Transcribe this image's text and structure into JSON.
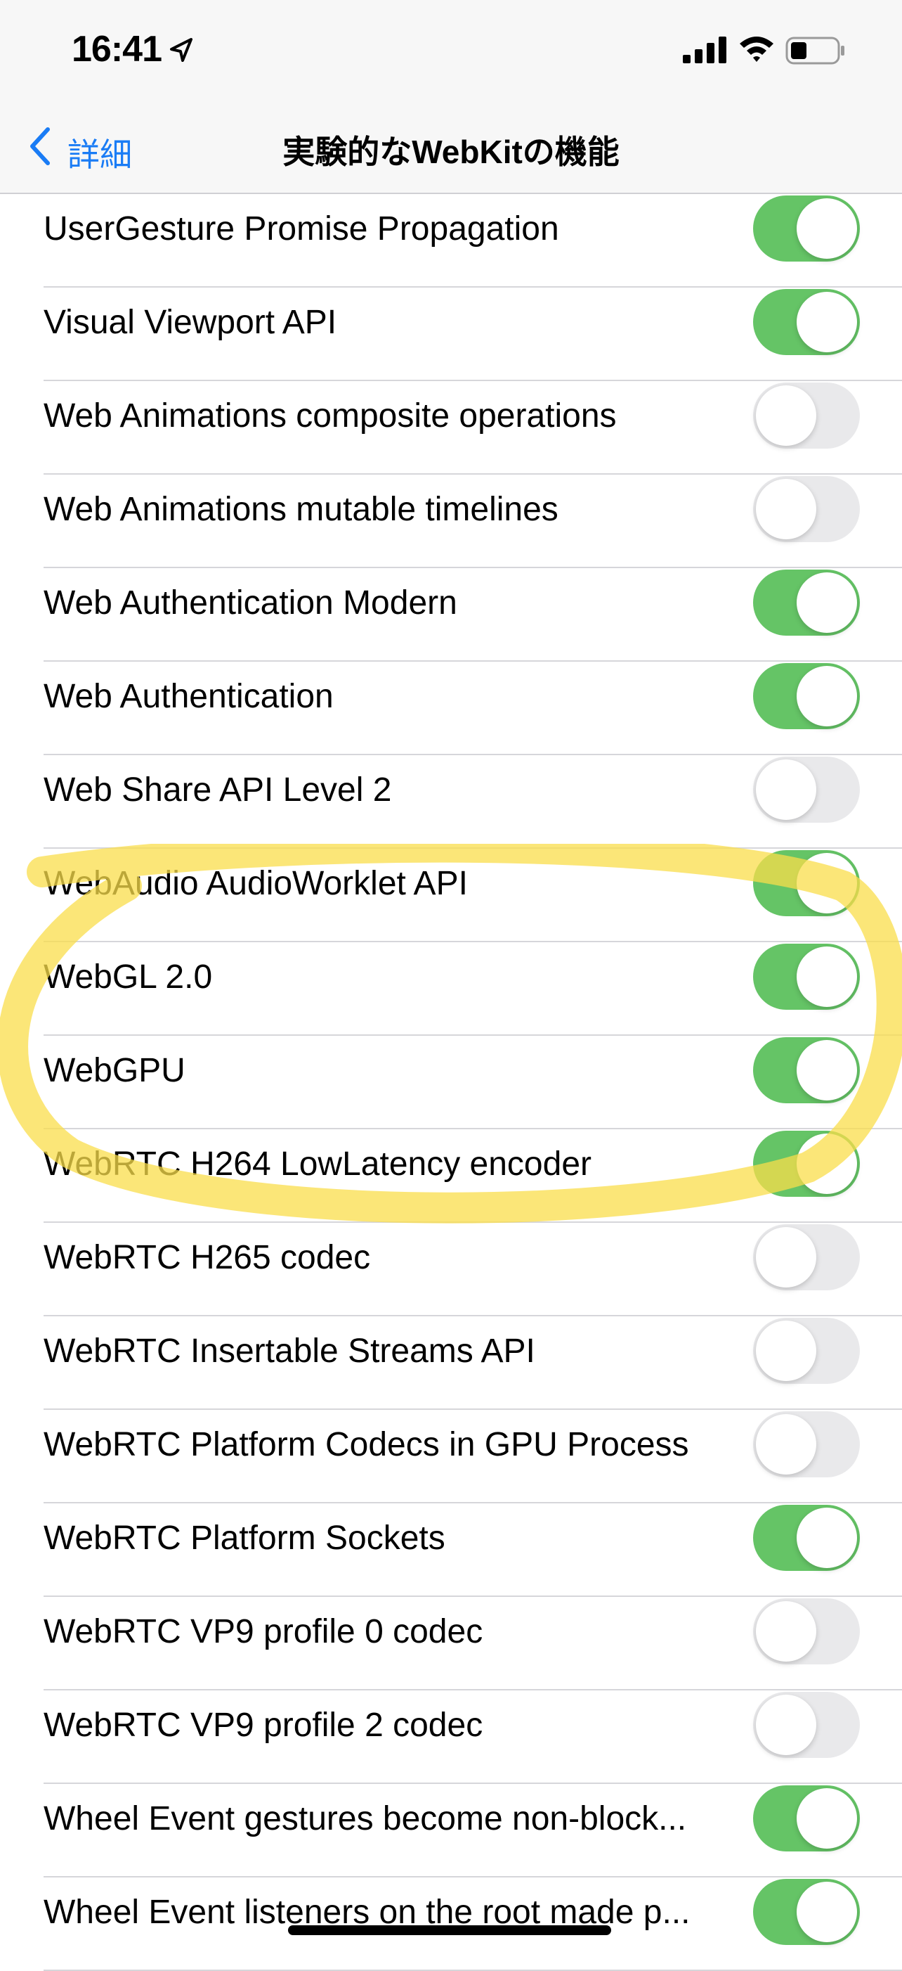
{
  "status_bar": {
    "time": "16:41",
    "icons": [
      "location-arrow-icon",
      "cellular-signal-icon",
      "wifi-icon",
      "battery-icon"
    ]
  },
  "nav": {
    "back_label": "詳細",
    "title": "実験的なWebKitの機能"
  },
  "colors": {
    "accent": "#1a7cf5",
    "toggle_on": "#65c466",
    "toggle_off": "#e9e9eb",
    "highlight": "#f9dd4b"
  },
  "features": [
    {
      "label": "UserGesture Promise Propagation",
      "on": true
    },
    {
      "label": "Visual Viewport API",
      "on": true
    },
    {
      "label": "Web Animations composite operations",
      "on": false
    },
    {
      "label": "Web Animations mutable timelines",
      "on": false
    },
    {
      "label": "Web Authentication Modern",
      "on": true
    },
    {
      "label": "Web Authentication",
      "on": true
    },
    {
      "label": "Web Share API Level 2",
      "on": false
    },
    {
      "label": "WebAudio AudioWorklet API",
      "on": true
    },
    {
      "label": "WebGL 2.0",
      "on": true
    },
    {
      "label": "WebGPU",
      "on": true
    },
    {
      "label": "WebRTC H264 LowLatency encoder",
      "on": true
    },
    {
      "label": "WebRTC H265 codec",
      "on": false
    },
    {
      "label": "WebRTC Insertable Streams API",
      "on": false
    },
    {
      "label": "WebRTC Platform Codecs in GPU Process",
      "on": false
    },
    {
      "label": "WebRTC Platform Sockets",
      "on": true
    },
    {
      "label": "WebRTC VP9 profile 0 codec",
      "on": false
    },
    {
      "label": "WebRTC VP9 profile 2 codec",
      "on": false
    },
    {
      "label": "Wheel Event gestures become non-block...",
      "on": true
    },
    {
      "label": "Wheel Event listeners on the root made p...",
      "on": true
    }
  ]
}
